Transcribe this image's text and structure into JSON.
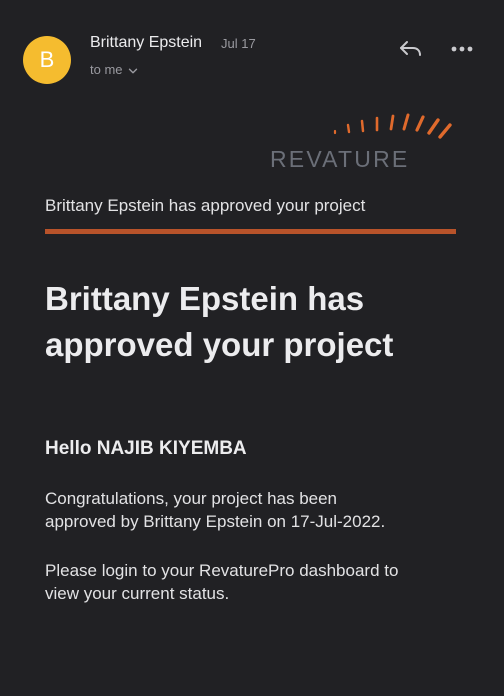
{
  "email": {
    "avatar_letter": "B",
    "sender": "Brittany Epstein",
    "date": "Jul 17",
    "recipient_label": "to me",
    "actions": {
      "reply_icon": "reply-icon",
      "more_icon": "more-horizontal-icon"
    }
  },
  "body": {
    "logo_text": "REVATURE",
    "subject_line": "Brittany Epstein has approved your project",
    "heading_line1": "Brittany Epstein has",
    "heading_line2": "approved your project",
    "greeting": "Hello NAJIB KIYEMBA",
    "paragraph1_line1": "Congratulations, your project has been",
    "paragraph1_line2": "approved by Brittany Epstein on 17-Jul-2022.",
    "paragraph2_line1": "Please login to your RevaturePro dashboard to",
    "paragraph2_line2": "view your current status."
  },
  "colors": {
    "background": "#212124",
    "avatar": "#f5bc2f",
    "accent": "#b8532a",
    "logo_text": "#6b6f78",
    "logo_rays": "#e06a2c"
  }
}
